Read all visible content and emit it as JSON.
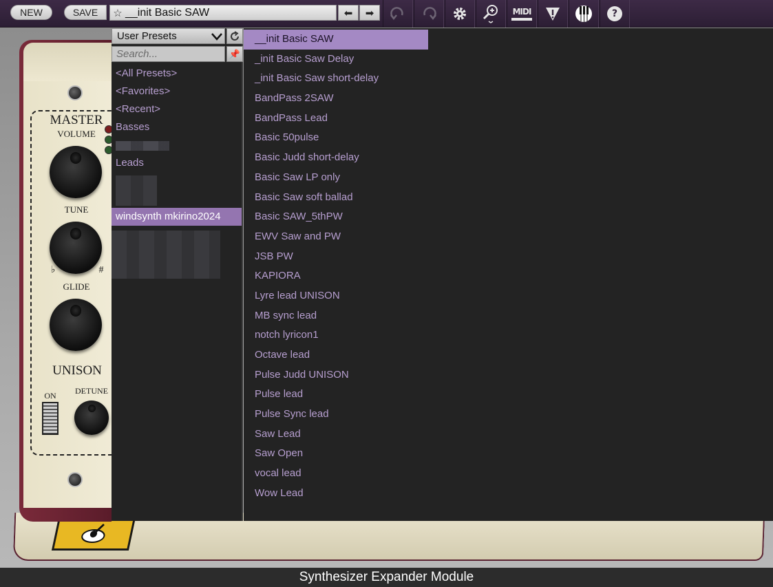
{
  "toolbar": {
    "new_label": "NEW",
    "save_label": "SAVE",
    "current_preset": "__init Basic SAW",
    "midi_label": "MIDI",
    "help_label": "?",
    "colors": {
      "background": "#33243b",
      "pill": "#d9d9d9"
    }
  },
  "browser": {
    "bank_dropdown": "User Presets",
    "search_placeholder": "Search...",
    "banks": [
      {
        "label": "<All Presets>"
      },
      {
        "label": "<Favorites>"
      },
      {
        "label": "<Recent>"
      },
      {
        "label": "Basses"
      },
      {
        "label": ""
      },
      {
        "label": "Leads"
      },
      {
        "label": ""
      },
      {
        "label": ""
      },
      {
        "label": "windsynth mkirino2024",
        "selected": true
      }
    ],
    "presets": [
      "__init Basic SAW",
      "_init Basic Saw Delay",
      "_init Basic Saw short-delay",
      "BandPass 2SAW",
      "BandPass Lead",
      "Basic 50pulse",
      "Basic Judd short-delay",
      "Basic Saw LP only",
      "Basic Saw soft ballad",
      "Basic SAW_5thPW",
      "EWV Saw and PW",
      "JSB PW",
      "KAPIORA",
      "Lyre lead UNISON",
      "MB sync lead",
      "notch lyricon1",
      "Octave lead",
      "Pulse Judd UNISON",
      "Pulse lead",
      "Pulse Sync lead",
      "Saw Lead",
      "Saw Open",
      "vocal lead",
      "Wow Lead"
    ],
    "selected_preset_index": 0,
    "colors": {
      "item": "#b79fd0",
      "selected_bg": "#a489c4",
      "panel_bg": "#232323"
    }
  },
  "module": {
    "master_label": "MASTER",
    "volume_label": "VOLUME",
    "tune_label": "TUNE",
    "flat_symbol": "♭",
    "sharp_symbol": "#",
    "glide_label": "GLIDE",
    "unison_label": "UNISON",
    "on_label": "ON",
    "detune_label": "DETUNE"
  },
  "footer": {
    "caption": "Synthesizer Expander Module"
  }
}
